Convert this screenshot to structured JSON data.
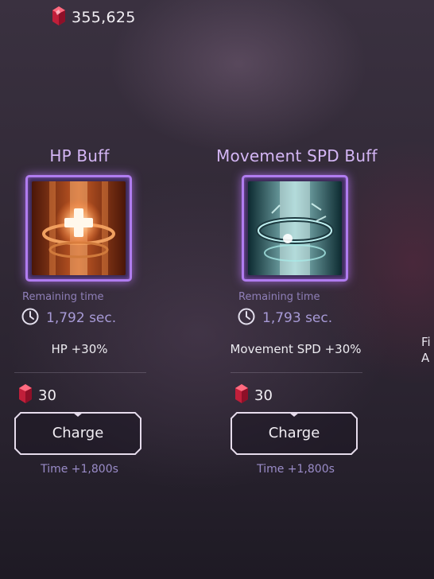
{
  "currency": {
    "icon": "red-gem-icon",
    "value": "355,625"
  },
  "cards": [
    {
      "title": "HP Buff",
      "icon": "hp-buff-icon",
      "remaining_label": "Remaining time",
      "timer_icon": "clock-icon",
      "remaining_value": "1,792 sec.",
      "effect": "HP +30%",
      "cost_icon": "red-gem-icon",
      "cost": "30",
      "button_label": "Charge",
      "time_bonus": "Time +1,800s"
    },
    {
      "title": "Movement SPD Buff",
      "icon": "movement-speed-buff-icon",
      "remaining_label": "Remaining time",
      "timer_icon": "clock-icon",
      "remaining_value": "1,793 sec.",
      "effect": "Movement SPD +30%",
      "cost_icon": "red-gem-icon",
      "cost": "30",
      "button_label": "Charge",
      "time_bonus": "Time +1,800s"
    }
  ],
  "edge_text": {
    "line1": "Fi",
    "line2": "A"
  },
  "colors": {
    "title": "#d4b6f5",
    "frame": "#b07cf0",
    "timer": "#a79ad6",
    "gem": "#d8304a"
  }
}
